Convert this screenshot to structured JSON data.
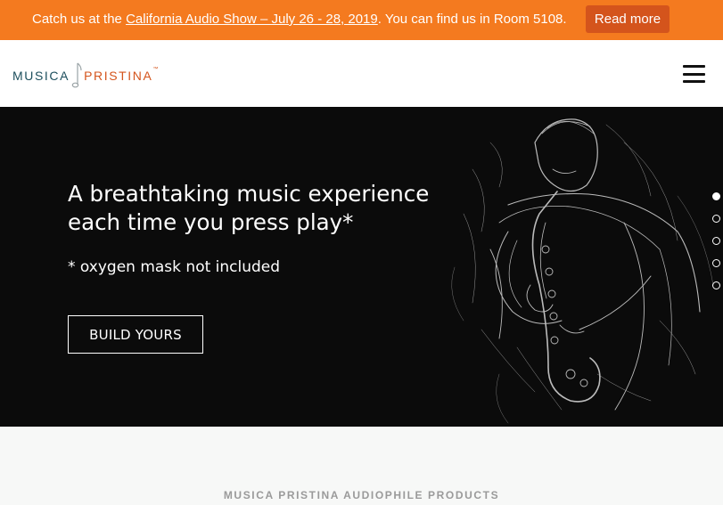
{
  "announcement": {
    "prefix": "Catch us at the ",
    "link_text": "California Audio Show – July 26 - 28, 2019",
    "suffix": ". You can find us in Room 5108.",
    "button_label": "Read more"
  },
  "header": {
    "logo_word1": "MUSICA",
    "logo_word2": "PRISTINA",
    "logo_mark": "™",
    "menu_icon": "hamburger-icon"
  },
  "hero": {
    "headline_line1": "A breathtaking music experience",
    "headline_line2": "each time you press play*",
    "subline": "* oxygen mask not included",
    "cta_label": "BUILD YOURS",
    "slides": [
      {
        "active": true
      },
      {
        "active": false
      },
      {
        "active": false
      },
      {
        "active": false
      },
      {
        "active": false
      }
    ],
    "image": "saxophone-player-sketch"
  },
  "products": {
    "title": "MUSICA PRISTINA AUDIOPHILE PRODUCTS"
  },
  "colors": {
    "accent": "#f47a1f",
    "button_dark": "#d4541c",
    "logo_teal": "#1d4f5d",
    "hero_bg": "#0b0b0b"
  }
}
